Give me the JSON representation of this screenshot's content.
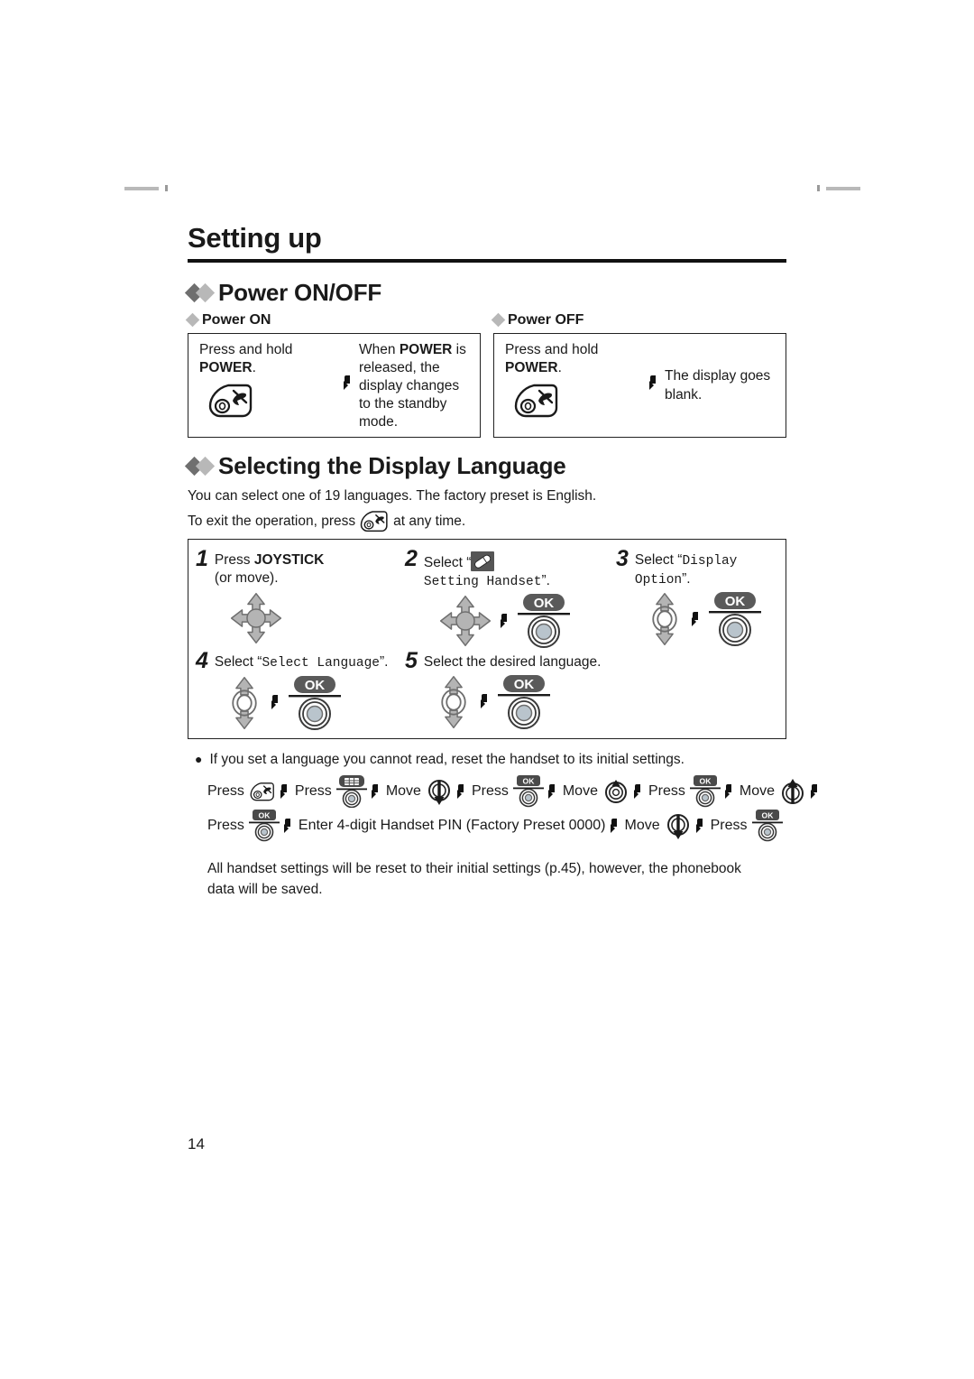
{
  "page_title": "Setting up",
  "page_number": "14",
  "sections": {
    "power": {
      "heading": "Power ON/OFF",
      "on": {
        "sub_heading": "Power ON",
        "left_line1": "Press and hold",
        "left_line2_bold": "POWER",
        "left_line2_after": ".",
        "icon": "power-key-icon",
        "arrow": "arrow-right-icon",
        "right_text_pre": "When ",
        "right_text_bold": "POWER",
        "right_text_post": " is released, the display changes to the standby mode."
      },
      "off": {
        "sub_heading": "Power OFF",
        "left_line1": "Press and hold",
        "left_line2_bold": "POWER",
        "left_line2_after": ".",
        "icon": "power-key-icon",
        "arrow": "arrow-right-icon",
        "right_text": "The display goes blank."
      }
    },
    "language": {
      "heading": "Selecting the Display Language",
      "intro": "You can select one of 19 languages. The factory preset is English.",
      "exit_pre": "To exit the operation, press",
      "exit_post": "at any time.",
      "steps": [
        {
          "num": "1",
          "text_pre": "Press ",
          "text_bold": "JOYSTICK",
          "text_post": "",
          "text_line2": "(or move).",
          "icons": [
            "joystick-4way-icon"
          ]
        },
        {
          "num": "2",
          "text_pre": "Select “",
          "menu_icon": "handset-setting-icon",
          "mono_text": "Setting Handset",
          "text_post": "”.",
          "icons": [
            "joystick-4way-icon",
            "arrow-right-icon",
            "ok-button-icon"
          ]
        },
        {
          "num": "3",
          "text_pre": "Select “",
          "mono_text": "Display Option",
          "text_post": "”.",
          "icons": [
            "joystick-updown-icon",
            "arrow-right-icon",
            "ok-button-icon"
          ]
        },
        {
          "num": "4",
          "text_pre": "Select “",
          "mono_text": "Select Language",
          "text_post": "”.",
          "icons": [
            "joystick-updown-icon",
            "arrow-right-icon",
            "ok-button-icon"
          ]
        },
        {
          "num": "5",
          "text_pre": "Select the desired language.",
          "mono_text": "",
          "text_post": "",
          "icons": [
            "joystick-updown-icon",
            "arrow-right-icon",
            "ok-button-icon"
          ]
        }
      ],
      "note": "If you set a language you cannot read, reset the handset to its initial settings.",
      "key_sequence_line1": [
        {
          "label": "Press",
          "icon": "power-key-icon"
        },
        {
          "label": "Press",
          "icon": "menu-key-icon"
        },
        {
          "label": "Move",
          "icon": "nav-down-icon"
        },
        {
          "label": "Press",
          "icon": "ok-key-icon"
        },
        {
          "label": "Move",
          "icon": "nav-updown-icon"
        },
        {
          "label": "Press",
          "icon": "ok-key-icon"
        },
        {
          "label": "Move",
          "icon": "nav-up-icon"
        }
      ],
      "key_sequence_line2": [
        {
          "label": "Press",
          "icon": "ok-key-icon"
        },
        {
          "label": "Enter 4-digit Handset PIN (Factory Preset 0000)",
          "icon": ""
        },
        {
          "label": "Move",
          "icon": "nav-down-icon"
        },
        {
          "label": "Press",
          "icon": "ok-key-icon"
        }
      ],
      "closing": "All handset settings will be reset to their initial settings (p.45), however, the phonebook data will be saved."
    }
  },
  "colors": {
    "diamond_dark": "#6f6f6f",
    "diamond_light": "#b8b8b8",
    "icon_gray": "#b0b0b0",
    "icon_dark": "#5a5a5a",
    "rule": "#111111"
  }
}
